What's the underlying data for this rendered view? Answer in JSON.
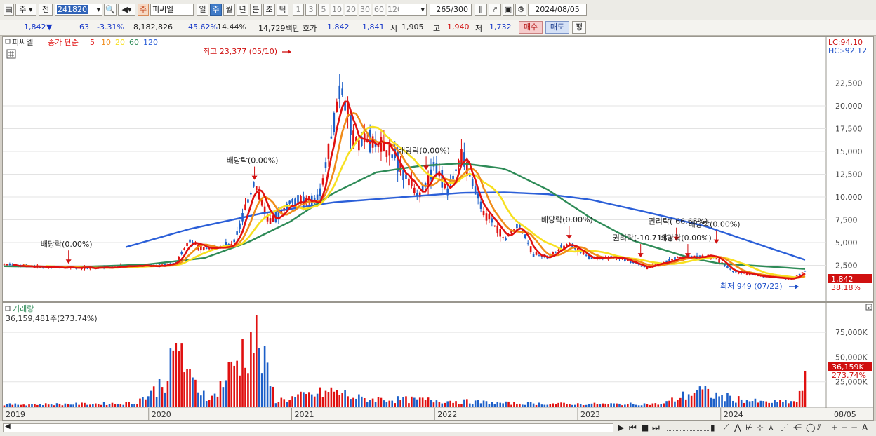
{
  "toolbar": {
    "market": "주",
    "period_type": "전",
    "stock_code": "241820",
    "stock_name": "피씨엘",
    "badge": "주",
    "periods": [
      "일",
      "주",
      "월",
      "년",
      "분",
      "초",
      "틱"
    ],
    "selected_period": "주",
    "units": [
      "1",
      "3",
      "5",
      "10",
      "20",
      "30",
      "60",
      "120"
    ],
    "count": "265",
    "count_max": "/300",
    "date": "2024/08/05"
  },
  "quote": {
    "price": "1,842",
    "direction": "▼",
    "change": "63",
    "change_pct": "-3.31%",
    "volume": "8,182,826",
    "vol_ratio": "45.62%",
    "turnover": "14.44%",
    "amount": "14,729백만",
    "ask_label": "호가",
    "ask": "1,842",
    "bid": "1,841",
    "open_label": "시",
    "open": "1,905",
    "high_label": "고",
    "high": "1,940",
    "low_label": "저",
    "low": "1,732",
    "buy_label": "매수",
    "sell_label": "매도",
    "avg_label": "평"
  },
  "chart": {
    "title": "피씨엘",
    "legend_prefix": "종가 단순",
    "ma_periods": [
      "5",
      "10",
      "20",
      "60",
      "120"
    ],
    "ma_colors": [
      "#e01010",
      "#f08c1a",
      "#f7e020",
      "#2e8b57",
      "#2b5fd8"
    ],
    "up_color": "#e01010",
    "down_color": "#1d5fc8",
    "lc_label": "LC:94.10",
    "hc_label": "HC:-92.12",
    "high_note": "최고 23,377 (05/10)",
    "low_note": "최저 949 (07/22)",
    "current_price_tag": "1,842",
    "current_pct_tag": "38.18%",
    "events": [
      "배당락(0.00%)",
      "배당락(0.00%)",
      "배당락(0.00%)",
      "배당락(0.00%)",
      "권리락(-10.71%)",
      "권리락(-66.65%)",
      "배당락(0.00%)",
      "배당락(0.00%)"
    ],
    "volume_title": "거래량",
    "volume_value": "36,159,481주(273.74%)",
    "volume_tag": "36,159K",
    "volume_pct_tag": "273.74%",
    "x_labels": [
      "2019",
      "2020",
      "2021",
      "2022",
      "2023",
      "2024"
    ],
    "x_right": "08/05"
  },
  "chart_data": {
    "type": "candlestick",
    "y_ticks": [
      "22,500",
      "20,000",
      "17,500",
      "15,000",
      "12,500",
      "10,000",
      "7,500",
      "5,000",
      "2,500"
    ],
    "ylim": [
      0,
      23500
    ],
    "volume_ticks": [
      "75,000K",
      "50,000K",
      "25,000K"
    ],
    "volume_ylim": [
      0,
      90000
    ],
    "years": [
      "2019",
      "2020",
      "2021",
      "2022",
      "2023",
      "2024"
    ],
    "ma120": [
      [
        2019.85,
        4500
      ],
      [
        2020.3,
        6500
      ],
      [
        2020.8,
        8200
      ],
      [
        2021.3,
        9400
      ],
      [
        2021.8,
        10000
      ],
      [
        2022.2,
        10450
      ],
      [
        2022.5,
        10500
      ],
      [
        2022.8,
        10300
      ],
      [
        2023.1,
        9700
      ],
      [
        2023.5,
        8300
      ],
      [
        2023.9,
        6800
      ],
      [
        2024.2,
        5200
      ],
      [
        2024.6,
        3100
      ]
    ],
    "ma60": [
      [
        2019.0,
        2400
      ],
      [
        2019.5,
        2300
      ],
      [
        2020.0,
        2600
      ],
      [
        2020.4,
        3300
      ],
      [
        2020.7,
        5000
      ],
      [
        2021.0,
        7300
      ],
      [
        2021.3,
        10400
      ],
      [
        2021.6,
        12700
      ],
      [
        2021.9,
        13400
      ],
      [
        2022.2,
        13700
      ],
      [
        2022.5,
        13100
      ],
      [
        2022.8,
        10800
      ],
      [
        2023.1,
        7700
      ],
      [
        2023.4,
        5200
      ],
      [
        2023.8,
        3300
      ],
      [
        2024.0,
        2700
      ],
      [
        2024.3,
        2400
      ],
      [
        2024.6,
        2100
      ]
    ],
    "price_path": [
      [
        2019.0,
        2600
      ],
      [
        2019.3,
        2300
      ],
      [
        2019.6,
        2200
      ],
      [
        2019.9,
        2400
      ],
      [
        2020.1,
        2500
      ],
      [
        2020.2,
        2800
      ],
      [
        2020.3,
        5200
      ],
      [
        2020.4,
        4300
      ],
      [
        2020.6,
        4800
      ],
      [
        2020.75,
        11500
      ],
      [
        2020.85,
        7200
      ],
      [
        2021.0,
        9400
      ],
      [
        2021.2,
        9600
      ],
      [
        2021.3,
        17500
      ],
      [
        2021.35,
        22300
      ],
      [
        2021.45,
        16300
      ],
      [
        2021.6,
        16000
      ],
      [
        2021.75,
        14100
      ],
      [
        2021.9,
        9800
      ],
      [
        2022.0,
        13600
      ],
      [
        2022.1,
        10800
      ],
      [
        2022.2,
        14500
      ],
      [
        2022.35,
        8500
      ],
      [
        2022.5,
        5300
      ],
      [
        2022.6,
        7000
      ],
      [
        2022.7,
        3700
      ],
      [
        2022.8,
        3400
      ],
      [
        2022.95,
        4900
      ],
      [
        2023.1,
        3300
      ],
      [
        2023.3,
        3400
      ],
      [
        2023.5,
        2200
      ],
      [
        2023.7,
        3300
      ],
      [
        2023.95,
        3500
      ],
      [
        2024.1,
        1800
      ],
      [
        2024.3,
        1300
      ],
      [
        2024.5,
        1000
      ],
      [
        2024.6,
        1842
      ]
    ],
    "volume_path": [
      [
        2019.1,
        2500
      ],
      [
        2019.5,
        3000
      ],
      [
        2019.9,
        4000
      ],
      [
        2020.05,
        18000
      ],
      [
        2020.15,
        40000
      ],
      [
        2020.2,
        62000
      ],
      [
        2020.23,
        85000
      ],
      [
        2020.27,
        35000
      ],
      [
        2020.45,
        9000
      ],
      [
        2020.75,
        85000
      ],
      [
        2020.9,
        7000
      ],
      [
        2021.3,
        18000
      ],
      [
        2021.5,
        9000
      ],
      [
        2022.0,
        7500
      ],
      [
        2022.5,
        4000
      ],
      [
        2023.0,
        3000
      ],
      [
        2023.6,
        3000
      ],
      [
        2023.85,
        19000
      ],
      [
        2024.0,
        12000
      ],
      [
        2024.3,
        5000
      ],
      [
        2024.55,
        6000
      ],
      [
        2024.6,
        36159
      ]
    ]
  }
}
